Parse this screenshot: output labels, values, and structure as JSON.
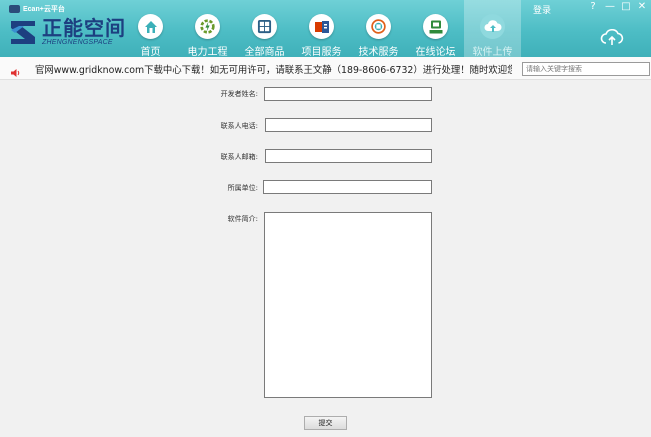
{
  "window": {
    "title": "Ecan+云平台",
    "login_label": "登录",
    "controls": {
      "help": "?",
      "minimize": "—",
      "maximize": "□",
      "close": "✕"
    }
  },
  "logo": {
    "cn": "正能空间",
    "en": "ZHENGNENGSPACE"
  },
  "nav": {
    "items": [
      {
        "label": "首页",
        "icon": "home-icon"
      },
      {
        "label": "电力工程",
        "icon": "gear-icon"
      },
      {
        "label": "全部商品",
        "icon": "grid-icon"
      },
      {
        "label": "项目服务",
        "icon": "office-icon"
      },
      {
        "label": "技术服务",
        "icon": "support-icon"
      },
      {
        "label": "在线论坛",
        "icon": "chat-icon"
      },
      {
        "label": "软件上传",
        "icon": "cloud-upload-icon",
        "active": true
      }
    ]
  },
  "notice": {
    "text": "官网www.gridknow.com下载中心下载！如无可用许可，请联系王文静（189-8606-6732）进行处理！随时欢迎您"
  },
  "search": {
    "placeholder": "请输入关键字搜索"
  },
  "form": {
    "developer_label": "开发者姓名:",
    "phone_label": "联系人电话:",
    "email_label": "联系人邮箱:",
    "unit_label": "所属单位:",
    "intro_label": "软件简介:",
    "submit_label": "提交"
  },
  "colors": {
    "header": "#4dbdc5",
    "logo_blue": "#1d3f80",
    "accent_red": "#e03030"
  }
}
